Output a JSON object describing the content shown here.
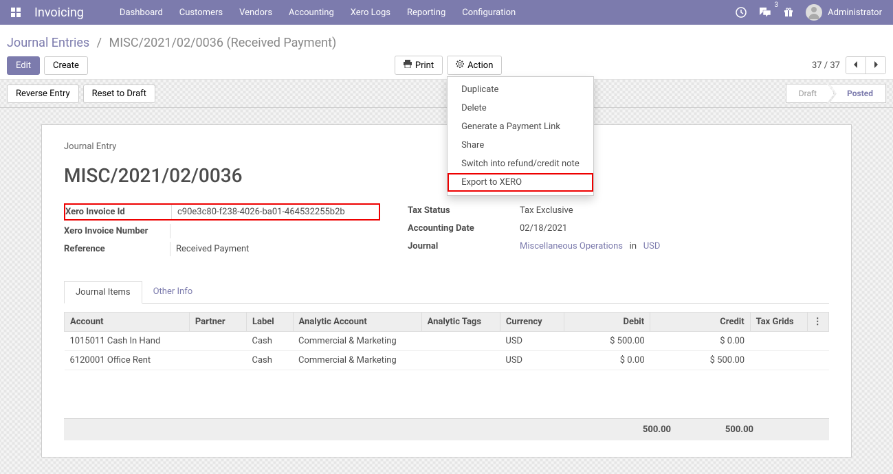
{
  "navbar": {
    "brand": "Invoicing",
    "menu": [
      "Dashboard",
      "Customers",
      "Vendors",
      "Accounting",
      "Xero Logs",
      "Reporting",
      "Configuration"
    ],
    "message_count": "3",
    "user_name": "Administrator"
  },
  "breadcrumb": {
    "link": "Journal Entries",
    "current": "MISC/2021/02/0036 (Received Payment)"
  },
  "buttons": {
    "edit": "Edit",
    "create": "Create",
    "print": "Print",
    "action": "Action",
    "reverse": "Reverse Entry",
    "reset": "Reset to Draft"
  },
  "action_menu": {
    "duplicate": "Duplicate",
    "del": "Delete",
    "payment_link": "Generate a Payment Link",
    "share": "Share",
    "refund": "Switch into refund/credit note",
    "export_xero": "Export to XERO"
  },
  "pager": {
    "text": "37 / 37"
  },
  "status": {
    "draft": "Draft",
    "posted": "Posted"
  },
  "sheet": {
    "label": "Journal Entry",
    "title": "MISC/2021/02/0036",
    "fields": {
      "xero_invoice_id_label": "Xero Invoice Id",
      "xero_invoice_id": "c90e3c80-f238-4026-ba01-464532255b2b",
      "xero_invoice_number_label": "Xero Invoice Number",
      "xero_invoice_number": "",
      "reference_label": "Reference",
      "reference": "Received Payment",
      "tax_status_label": "Tax Status",
      "tax_status": "Tax Exclusive",
      "accounting_date_label": "Accounting Date",
      "accounting_date": "02/18/2021",
      "journal_label": "Journal",
      "journal_op": "Miscellaneous Operations",
      "journal_in": "in",
      "journal_currency": "USD"
    }
  },
  "tabs": {
    "journal_items": "Journal Items",
    "other_info": "Other Info"
  },
  "table": {
    "headers": {
      "account": "Account",
      "partner": "Partner",
      "label": "Label",
      "analytic_account": "Analytic Account",
      "analytic_tags": "Analytic Tags",
      "currency": "Currency",
      "debit": "Debit",
      "credit": "Credit",
      "tax_grids": "Tax Grids"
    },
    "rows": [
      {
        "account": "1015011 Cash In Hand",
        "partner": "",
        "label": "Cash",
        "analytic_account": "Commercial & Marketing",
        "analytic_tags": "",
        "currency": "USD",
        "debit": "$ 500.00",
        "credit": "$ 0.00",
        "tax_grids": ""
      },
      {
        "account": "6120001 Office Rent",
        "partner": "",
        "label": "Cash",
        "analytic_account": "Commercial & Marketing",
        "analytic_tags": "",
        "currency": "USD",
        "debit": "$ 0.00",
        "credit": "$ 500.00",
        "tax_grids": ""
      }
    ],
    "totals": {
      "debit": "500.00",
      "credit": "500.00"
    }
  }
}
